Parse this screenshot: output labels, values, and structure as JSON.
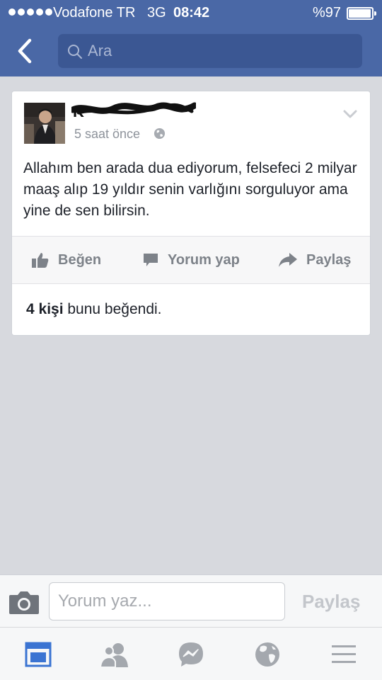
{
  "status_bar": {
    "carrier": "Vodafone TR",
    "network": "3G",
    "time": "08:42",
    "battery": "%97"
  },
  "nav": {
    "search_placeholder": "Ara"
  },
  "post": {
    "author_name": "K",
    "time": "5 saat önce",
    "text": "Allahım ben arada dua ediyorum, felsefeci 2 milyar maaş alıp 19 yıldır senin varlığını sorguluyor ama yine de sen bilirsin.",
    "actions": {
      "like": "Beğen",
      "comment": "Yorum yap",
      "share": "Paylaş"
    },
    "likes_count": "4 kişi",
    "likes_suffix": " bunu beğendi."
  },
  "composer": {
    "placeholder": "Yorum yaz...",
    "send_label": "Paylaş"
  },
  "colors": {
    "header": "#4a68a6",
    "search_field": "#3b5793",
    "active_tab": "#3b74d2",
    "inactive_icon": "#a4a8ae"
  }
}
